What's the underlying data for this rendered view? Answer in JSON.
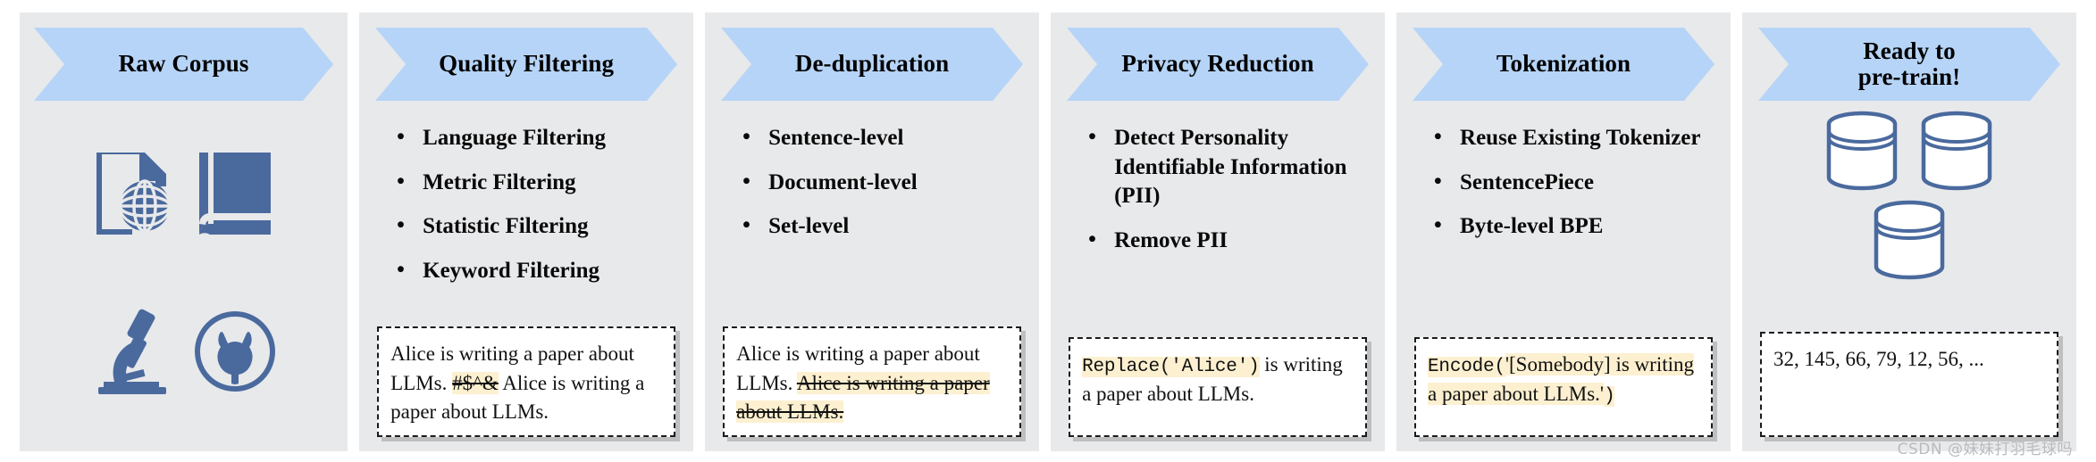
{
  "colors": {
    "panel_background": "#e8e9eb",
    "banner_fill": "#b6d4f7",
    "icon_blue": "#4a6a9e",
    "highlight": "#fdf0d0",
    "page_background": "#ffffff",
    "text": "#000000",
    "watermark": "#b9bbbe"
  },
  "panels": [
    {
      "id": "raw-corpus",
      "title": "Raw Corpus",
      "icons": [
        "webpage-globe-icon",
        "book-icon",
        "microscope-icon",
        "github-cat-icon"
      ],
      "bullets": [],
      "sample": null
    },
    {
      "id": "quality-filtering",
      "title": "Quality Filtering",
      "icons": [],
      "bullets": [
        "Language Filtering",
        "Metric Filtering",
        "Statistic Filtering",
        "Keyword Filtering"
      ],
      "sample": {
        "segments": [
          {
            "text": "Alice is writing a paper about LLMs. ",
            "style": "plain"
          },
          {
            "text": "#$^&",
            "style": "highlight-strike"
          },
          {
            "text": " Alice is writing a paper about LLMs.",
            "style": "plain"
          }
        ]
      }
    },
    {
      "id": "de-duplication",
      "title": "De-duplication",
      "icons": [],
      "bullets": [
        "Sentence-level",
        "Document-level",
        "Set-level"
      ],
      "sample": {
        "segments": [
          {
            "text": "Alice is writing a paper about LLMs. ",
            "style": "plain"
          },
          {
            "text": "Alice is writing a paper about LLMs.",
            "style": "highlight-strike"
          }
        ]
      }
    },
    {
      "id": "privacy-reduction",
      "title": "Privacy Reduction",
      "icons": [],
      "bullets": [
        "Detect Personality Identifiable Information (PII)",
        "Remove PII"
      ],
      "sample": {
        "segments": [
          {
            "text": "Replace('Alice')",
            "style": "highlight-mono"
          },
          {
            "text": " is writing a paper about LLMs.",
            "style": "plain"
          }
        ]
      }
    },
    {
      "id": "tokenization",
      "title": "Tokenization",
      "icons": [],
      "bullets": [
        "Reuse Existing Tokenizer",
        "SentencePiece",
        "Byte-level BPE"
      ],
      "sample": {
        "segments": [
          {
            "text": "Encode(",
            "style": "highlight-mono"
          },
          {
            "text": "'[Somebody] is writing a paper about LLMs.'",
            "style": "highlight"
          },
          {
            "text": ")",
            "style": "highlight-mono"
          }
        ]
      }
    },
    {
      "id": "ready-to-pretrain",
      "title": "Ready to pre-train!",
      "title_line1": "Ready to",
      "title_line2": "pre-train!",
      "icons": [
        "database-icon",
        "database-icon",
        "database-icon"
      ],
      "bullets": [],
      "sample": {
        "segments": [
          {
            "text": "32, 145, 66, 79, 12, 56, ...",
            "style": "plain"
          }
        ]
      }
    }
  ],
  "watermark": "CSDN @妹妹打羽毛球吗"
}
